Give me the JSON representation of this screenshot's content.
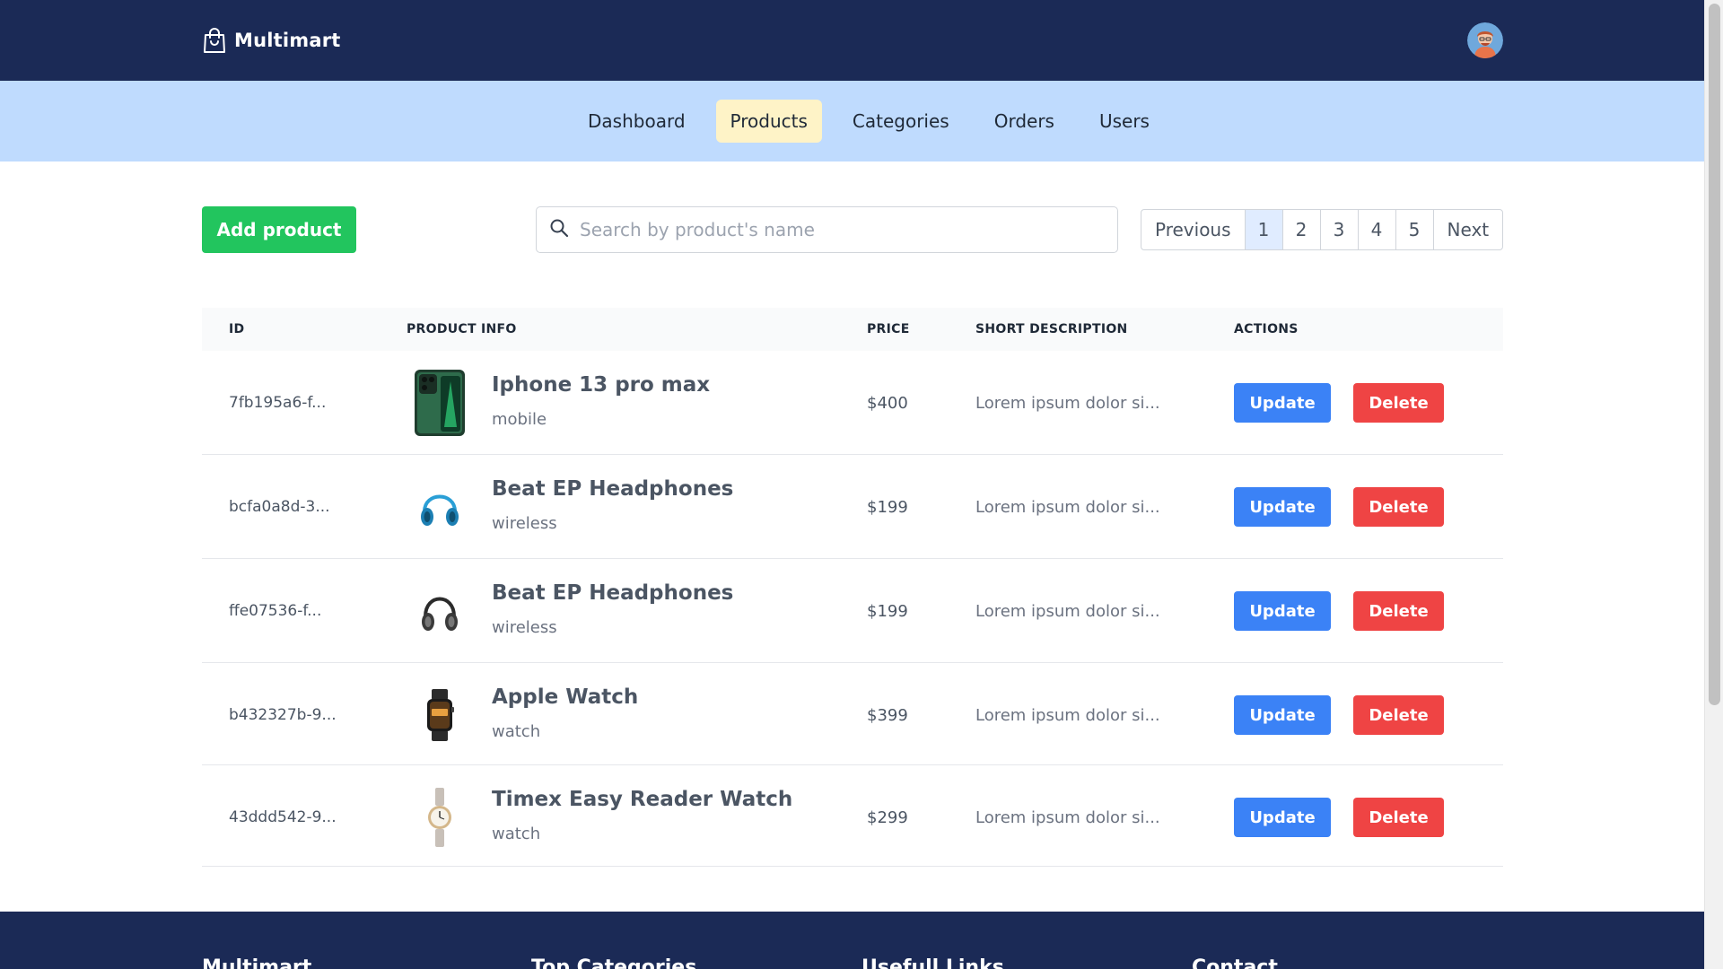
{
  "brand": {
    "name": "Multimart"
  },
  "nav": {
    "items": [
      {
        "label": "Dashboard",
        "active": false
      },
      {
        "label": "Products",
        "active": true
      },
      {
        "label": "Categories",
        "active": false
      },
      {
        "label": "Orders",
        "active": false
      },
      {
        "label": "Users",
        "active": false
      }
    ]
  },
  "toolbar": {
    "add_label": "Add product",
    "search_placeholder": "Search by product's name"
  },
  "pagination": {
    "previous": "Previous",
    "next": "Next",
    "pages": [
      "1",
      "2",
      "3",
      "4",
      "5"
    ],
    "current": "1"
  },
  "table": {
    "headers": {
      "id": "ID",
      "info": "PRODUCT INFO",
      "price": "PRICE",
      "desc": "SHORT DESCRIPTION",
      "actions": "ACTIONS"
    },
    "update_label": "Update",
    "delete_label": "Delete",
    "rows": [
      {
        "id": "7fb195a6-f...",
        "name": "Iphone 13 pro max",
        "category": "mobile",
        "price": "$400",
        "desc": "Lorem ipsum dolor si...",
        "thumb": "phone-icon"
      },
      {
        "id": "bcfa0a8d-3...",
        "name": "Beat EP Headphones",
        "category": "wireless",
        "price": "$199",
        "desc": "Lorem ipsum dolor si...",
        "thumb": "headphones-blue-icon"
      },
      {
        "id": "ffe07536-f...",
        "name": "Beat EP Headphones",
        "category": "wireless",
        "price": "$199",
        "desc": "Lorem ipsum dolor si...",
        "thumb": "headphones-black-icon"
      },
      {
        "id": "b432327b-9...",
        "name": "Apple Watch",
        "category": "watch",
        "price": "$399",
        "desc": "Lorem ipsum dolor si...",
        "thumb": "smartwatch-icon"
      },
      {
        "id": "43ddd542-9...",
        "name": "Timex Easy Reader Watch",
        "category": "watch",
        "price": "$299",
        "desc": "Lorem ipsum dolor si...",
        "thumb": "wristwatch-icon"
      }
    ]
  },
  "footer": {
    "columns": [
      "Multimart",
      "Top Categories",
      "Usefull Links",
      "Contact"
    ]
  },
  "colors": {
    "header_bg": "#1b2a56",
    "nav_bg": "#bfdbfe",
    "active_tab": "#fef3c7",
    "add_button": "#22c55e",
    "update_button": "#3b82f6",
    "delete_button": "#ef4444"
  }
}
